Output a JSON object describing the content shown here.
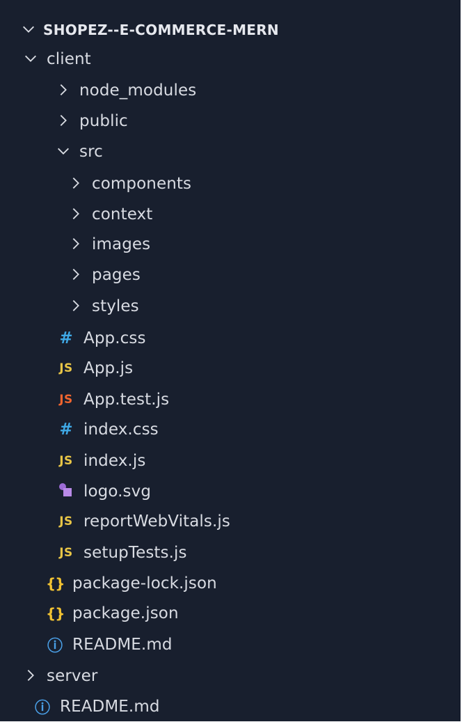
{
  "explorer": {
    "root": {
      "label": "SHOPEZ--E-COMMERCE-MERN",
      "expanded": true
    },
    "items": [
      {
        "label": "client",
        "type": "folder",
        "expanded": true,
        "depth": 1
      },
      {
        "label": "node_modules",
        "type": "folder",
        "expanded": false,
        "depth": 2
      },
      {
        "label": "public",
        "type": "folder",
        "expanded": false,
        "depth": 2
      },
      {
        "label": "src",
        "type": "folder",
        "expanded": true,
        "depth": 2
      },
      {
        "label": "components",
        "type": "folder",
        "expanded": false,
        "depth": 3
      },
      {
        "label": "context",
        "type": "folder",
        "expanded": false,
        "depth": 3
      },
      {
        "label": "images",
        "type": "folder",
        "expanded": false,
        "depth": 3
      },
      {
        "label": "pages",
        "type": "folder",
        "expanded": false,
        "depth": 3
      },
      {
        "label": "styles",
        "type": "folder",
        "expanded": false,
        "depth": 3
      },
      {
        "label": "App.css",
        "type": "file",
        "icon": "css-hash-icon",
        "icon_text": "#",
        "icon_color": "#3fa9e6",
        "depth": 3
      },
      {
        "label": "App.js",
        "type": "file",
        "icon": "js-icon",
        "icon_text": "JS",
        "icon_color": "#e8c547",
        "depth": 3
      },
      {
        "label": "App.test.js",
        "type": "file",
        "icon": "js-test-icon",
        "icon_text": "JS",
        "icon_color": "#f0652f",
        "depth": 3
      },
      {
        "label": "index.css",
        "type": "file",
        "icon": "css-hash-icon",
        "icon_text": "#",
        "icon_color": "#3fa9e6",
        "depth": 3
      },
      {
        "label": "index.js",
        "type": "file",
        "icon": "js-icon",
        "icon_text": "JS",
        "icon_color": "#e8c547",
        "depth": 3
      },
      {
        "label": "logo.svg",
        "type": "file",
        "icon": "svg-shapes-icon",
        "icon_text": "",
        "icon_color": "#b07be6",
        "depth": 3
      },
      {
        "label": "reportWebVitals.js",
        "type": "file",
        "icon": "js-icon",
        "icon_text": "JS",
        "icon_color": "#e8c547",
        "depth": 3
      },
      {
        "label": "setupTests.js",
        "type": "file",
        "icon": "js-icon",
        "icon_text": "JS",
        "icon_color": "#e8c547",
        "depth": 3
      },
      {
        "label": "package-lock.json",
        "type": "file",
        "icon": "json-braces-icon",
        "icon_text": "{}",
        "icon_color": "#f1c232",
        "depth": 2
      },
      {
        "label": "package.json",
        "type": "file",
        "icon": "json-braces-icon",
        "icon_text": "{}",
        "icon_color": "#f1c232",
        "depth": 2
      },
      {
        "label": "README.md",
        "type": "file",
        "icon": "info-icon",
        "icon_text": "ⓘ",
        "icon_color": "#4a9fe6",
        "depth": 2
      },
      {
        "label": "server",
        "type": "folder",
        "expanded": false,
        "depth": 1
      },
      {
        "label": "README.md",
        "type": "file",
        "icon": "info-icon",
        "icon_text": "ⓘ",
        "icon_color": "#4a9fe6",
        "depth": 1
      }
    ]
  },
  "colors": {
    "background": "#181f2e",
    "text": "#d8dbe2"
  }
}
